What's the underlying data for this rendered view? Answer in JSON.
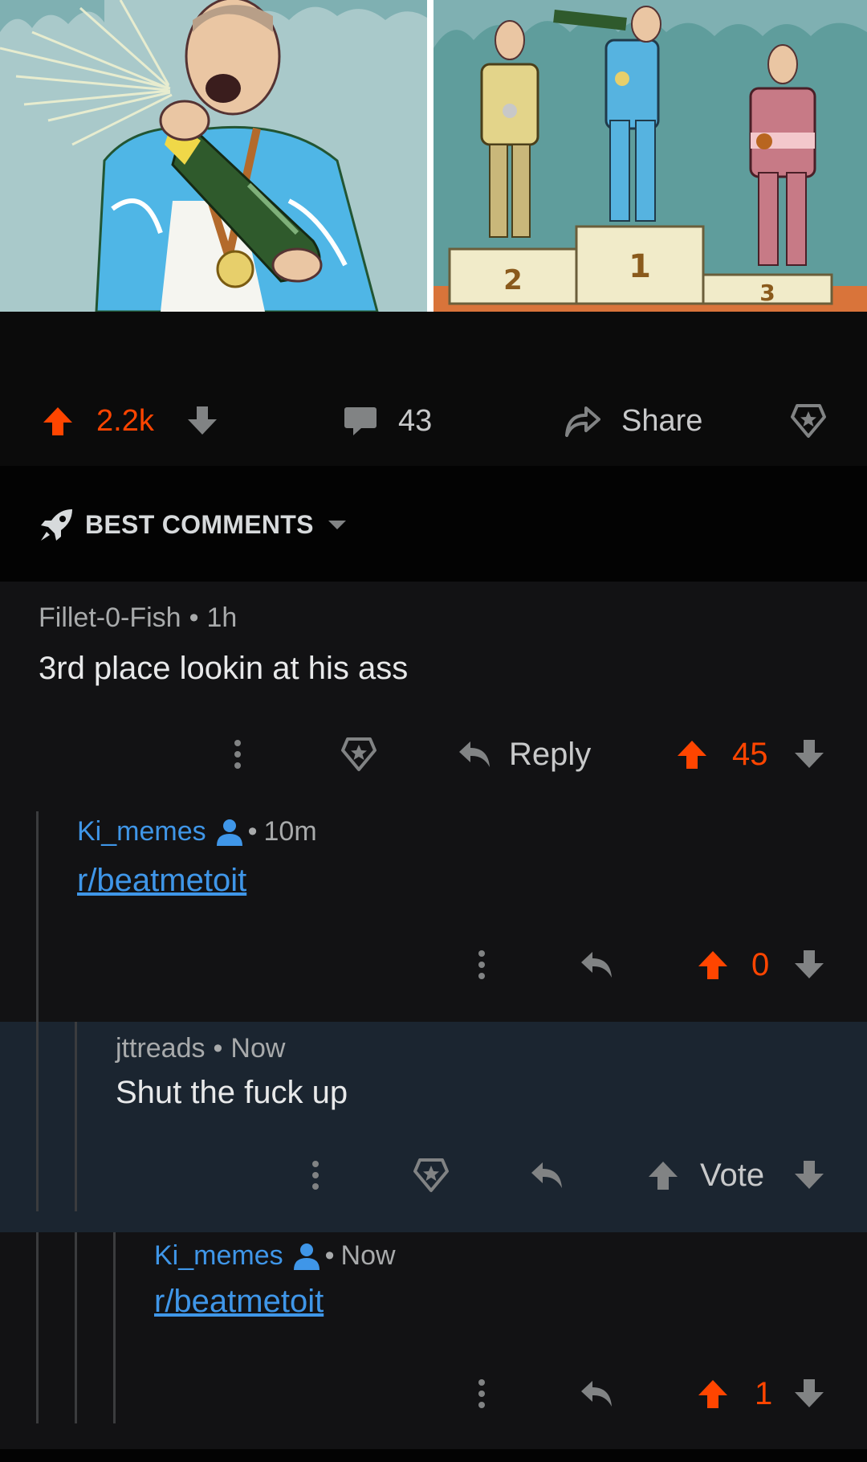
{
  "post": {
    "score": "2.2k",
    "comment_count": "43",
    "share_label": "Share"
  },
  "podium": {
    "first": "1",
    "second": "2",
    "third": "3"
  },
  "sort": {
    "label": "BEST COMMENTS"
  },
  "comments": [
    {
      "author": "Fillet-0-Fish",
      "separator": "•",
      "time": "1h",
      "body": "3rd place lookin at his ass",
      "reply_label": "Reply",
      "score": "45"
    },
    {
      "author": "Ki_memes",
      "separator": "•",
      "time": "10m",
      "body": "r/beatmetoit",
      "score": "0"
    },
    {
      "author": "jttreads",
      "separator": "•",
      "time": "Now",
      "body": "Shut the fuck up",
      "vote_label": "Vote"
    },
    {
      "author": "Ki_memes",
      "separator": "•",
      "time": "Now",
      "body": "r/beatmetoit",
      "score": "1"
    }
  ],
  "colors": {
    "upvote": "#ff4500",
    "link": "#3f96e8",
    "muted_icon": "#818384",
    "highlight_bg": "#1b2530"
  },
  "icons": [
    "upvote-arrow-icon",
    "downvote-arrow-icon",
    "comment-bubble-icon",
    "share-arrow-icon",
    "award-icon",
    "rocket-icon",
    "caret-down-icon",
    "more-dots-icon",
    "reply-arrow-icon",
    "user-icon"
  ]
}
